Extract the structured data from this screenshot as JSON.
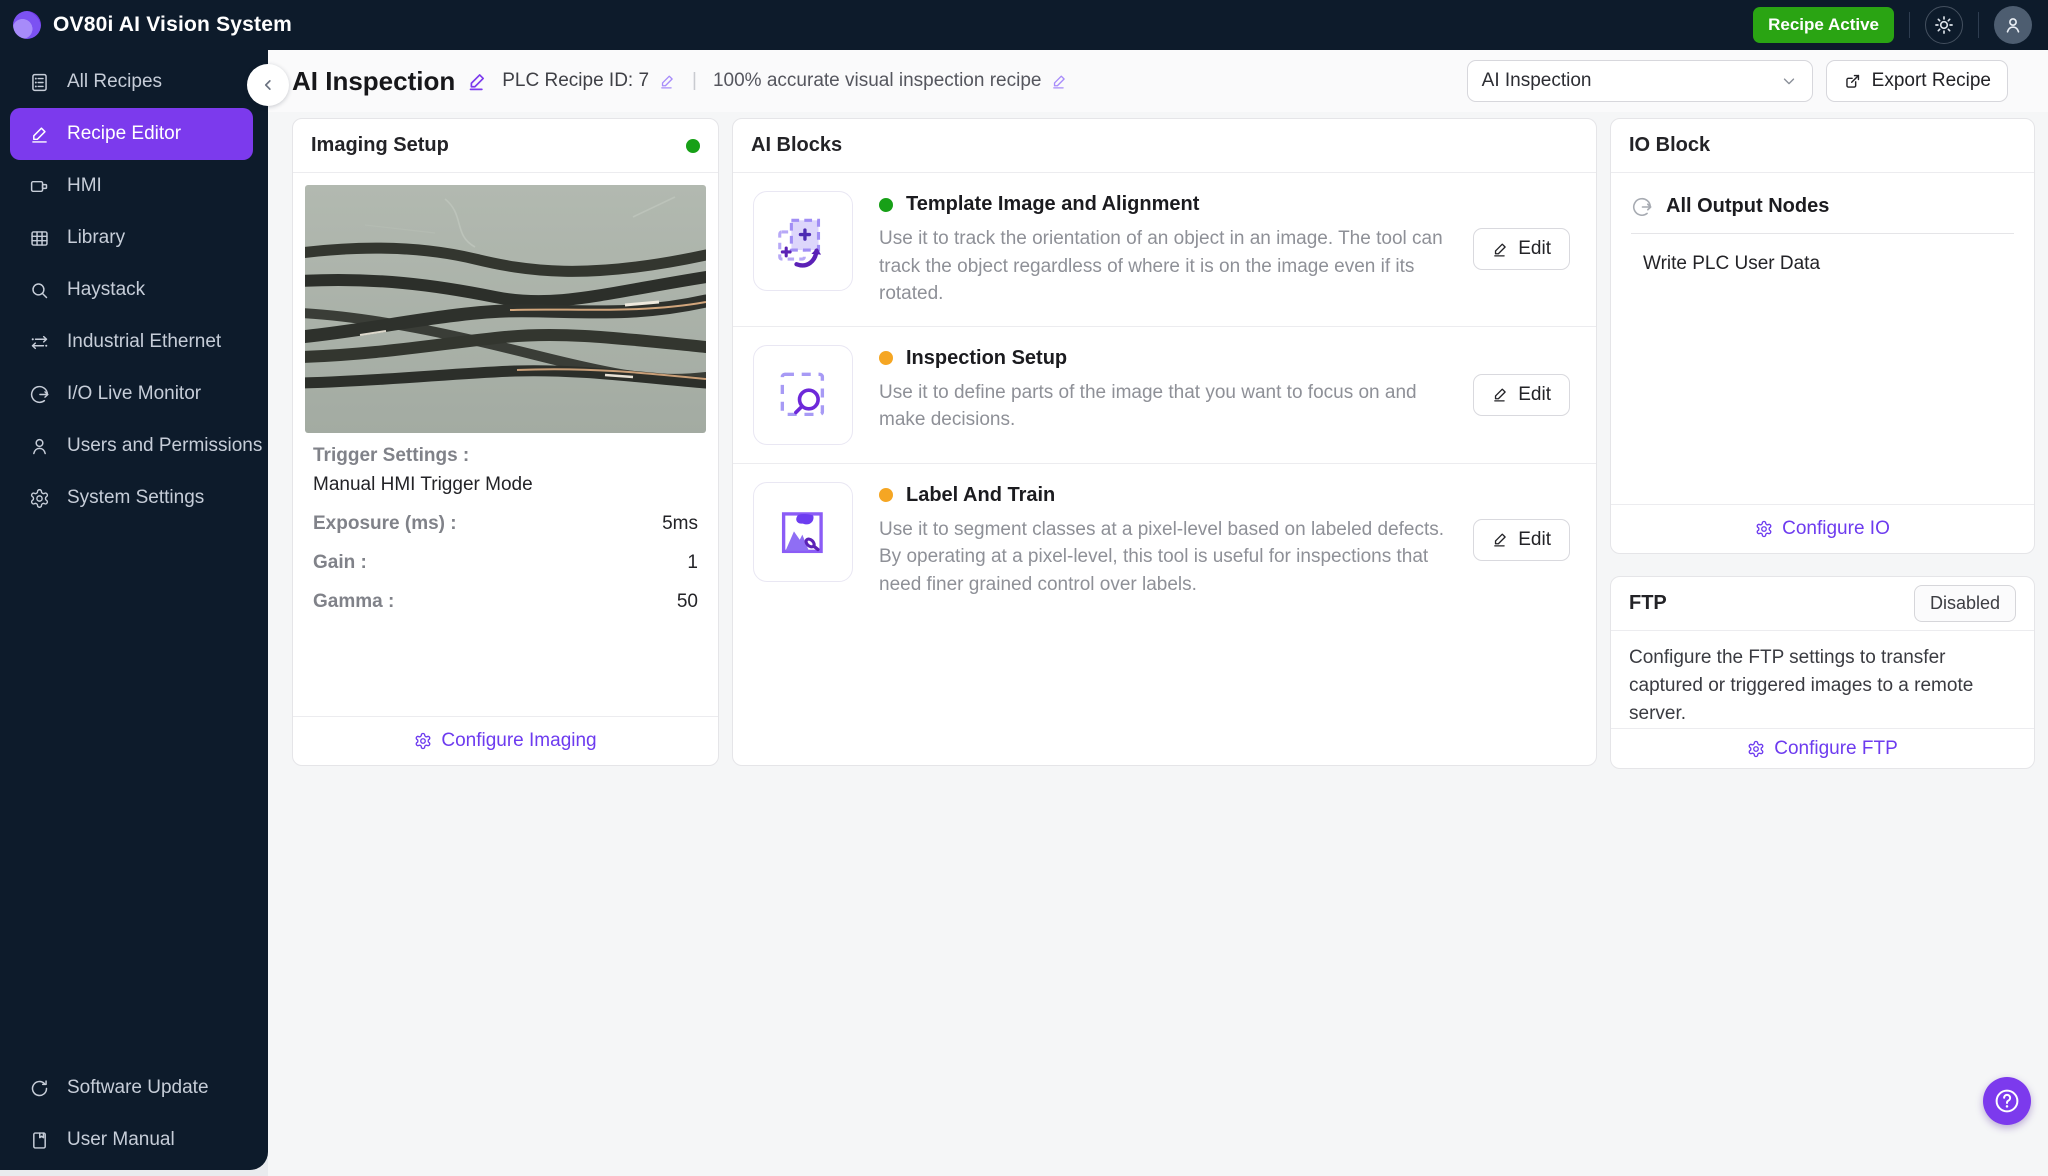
{
  "app": {
    "title": "OV80i AI Vision System"
  },
  "topbar": {
    "badge": "Recipe Active"
  },
  "sidebar": {
    "items": [
      {
        "label": "All Recipes"
      },
      {
        "label": "Recipe Editor",
        "active": true
      },
      {
        "label": "HMI"
      },
      {
        "label": "Library"
      },
      {
        "label": "Haystack"
      },
      {
        "label": "Industrial Ethernet"
      },
      {
        "label": "I/O Live Monitor"
      },
      {
        "label": "Users and Permissions"
      },
      {
        "label": "System Settings"
      }
    ],
    "footer_items": [
      {
        "label": "Software Update"
      },
      {
        "label": "User Manual"
      }
    ]
  },
  "header": {
    "title": "AI Inspection",
    "plc_label": "PLC Recipe ID: 7",
    "separator": "|",
    "subtitle": "100% accurate visual inspection recipe",
    "recipe_selector_value": "AI Inspection",
    "export_label": "Export Recipe"
  },
  "imaging": {
    "title": "Imaging Setup",
    "status": "green",
    "trigger_label": "Trigger Settings :",
    "trigger_mode": "Manual HMI Trigger Mode",
    "settings": [
      {
        "label": "Exposure (ms) :",
        "value": "5ms"
      },
      {
        "label": "Gain :",
        "value": "1"
      },
      {
        "label": "Gamma :",
        "value": "50"
      }
    ],
    "configure_label": "Configure Imaging"
  },
  "ai_blocks": {
    "title": "AI Blocks",
    "edit_label": "Edit",
    "blocks": [
      {
        "status": "green",
        "name": "Template Image and Alignment",
        "description": "Use it to track the orientation of an object in an image. The tool can track the object regardless of where it is on the image even if its rotated."
      },
      {
        "status": "orange",
        "name": "Inspection Setup",
        "description": "Use it to define parts of the image that you want to focus on and make decisions."
      },
      {
        "status": "orange",
        "name": "Label And Train",
        "description": "Use it to segment classes at a pixel-level based on labeled defects. By operating at a pixel-level, this tool is useful for inspections that need finer grained control over labels."
      }
    ]
  },
  "io_block": {
    "title": "IO Block",
    "section_title": "All Output Nodes",
    "node": "Write PLC User Data",
    "configure_label": "Configure IO"
  },
  "ftp": {
    "title": "FTP",
    "status_label": "Disabled",
    "description": "Configure the FTP settings to transfer captured or triggered images to a remote server.",
    "configure_label": "Configure FTP"
  },
  "colors": {
    "accent_purple": "#7c3aed",
    "badge_green": "#2aa413",
    "status_green": "#17a017",
    "status_orange": "#f5a623",
    "sidebar_bg": "#0d1b2b"
  }
}
